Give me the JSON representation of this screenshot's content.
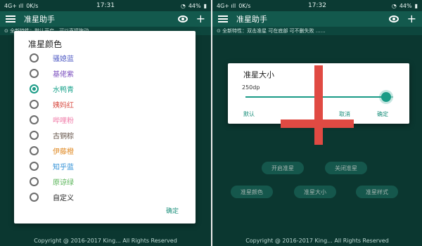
{
  "screenA": {
    "status": {
      "carrier": "4G+ ıll",
      "speed": "0K/s",
      "time": "17:31",
      "battery": "44%"
    },
    "toolbar": {
      "title": "准星助手"
    },
    "notice": "⊙ 全新特性：默认开启，可以直接拖动 ……",
    "dialog": {
      "title": "准星颜色",
      "options": [
        {
          "label": "骚媳蓝",
          "color": "#5560c6",
          "checked": false
        },
        {
          "label": "基佬紫",
          "color": "#7b4fbf",
          "checked": false
        },
        {
          "label": "水鸭青",
          "color": "#1aa38c",
          "checked": true
        },
        {
          "label": "姨妈红",
          "color": "#d84b42",
          "checked": false
        },
        {
          "label": "哔哩粉",
          "color": "#f07eaa",
          "checked": false
        },
        {
          "label": "古铜棕",
          "color": "#5b4a3f",
          "checked": false
        },
        {
          "label": "伊藤橙",
          "color": "#e08a25",
          "checked": false
        },
        {
          "label": "知乎蓝",
          "color": "#2e8fd6",
          "checked": false
        },
        {
          "label": "原谅绿",
          "color": "#5bb55a",
          "checked": false
        },
        {
          "label": "自定义",
          "color": "#222222",
          "checked": false
        }
      ],
      "confirm": "确定"
    },
    "copyright": "Copyright @ 2016-2017 King... All Rights Reserved"
  },
  "screenB": {
    "status": {
      "carrier": "4G+ ıll",
      "speed": "0K/s",
      "time": "17:32",
      "battery": "44%"
    },
    "toolbar": {
      "title": "准星助手"
    },
    "notice": "⊙ 全新特性：双击准星 可在底部 可不删失败 ……",
    "fab": "+",
    "buttons": {
      "enable": "开启准星",
      "disable": "关闭准星",
      "color": "准星颜色",
      "size": "准星大小",
      "style": "准星样式"
    },
    "dialog": {
      "title": "准星大小",
      "value": "250dp",
      "level": 0.95,
      "default": "默认",
      "cancel": "取消",
      "confirm": "确定"
    },
    "copyright": "Copyright @ 2016-2017 King... All Rights Reserved"
  }
}
